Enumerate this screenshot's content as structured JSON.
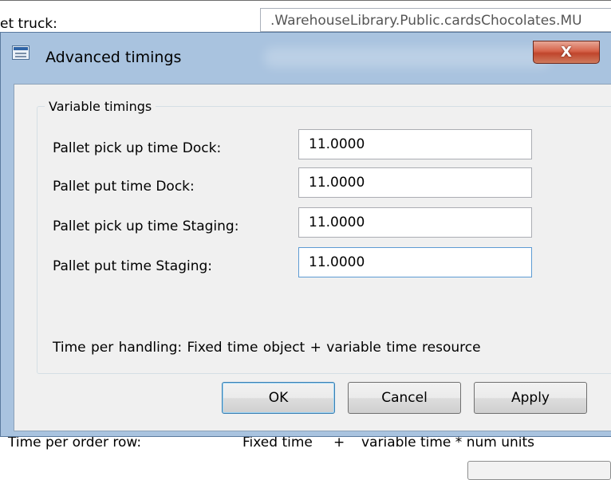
{
  "background_window": {
    "label": "et truck:",
    "field_value": ".WarehouseLibrary.Public.cardsChocolates.MU",
    "bottom_row": {
      "label": "Time per order row:",
      "fixed": "Fixed time",
      "plus": "+",
      "variable": "variable time * num units"
    }
  },
  "dialog": {
    "title": "Advanced timings",
    "close_glyph": "X",
    "group_title": "Variable timings",
    "fields": [
      {
        "label": "Pallet pick up time Dock:",
        "value": "11.0000"
      },
      {
        "label": "Pallet put time Dock:",
        "value": "11.0000"
      },
      {
        "label": "Pallet pick up time Staging:",
        "value": "11.0000"
      },
      {
        "label": "Pallet put time Staging:",
        "value": "11.0000"
      }
    ],
    "info_text": "Time per handling: Fixed time object  +  variable time resource",
    "buttons": {
      "ok": "OK",
      "cancel": "Cancel",
      "apply": "Apply"
    }
  },
  "colors": {
    "title_bar": "#a9c3df",
    "close_button": "#c9533a",
    "client_area": "#f0f0f0"
  },
  "icons": {
    "window": "window-icon",
    "close": "close-icon"
  }
}
